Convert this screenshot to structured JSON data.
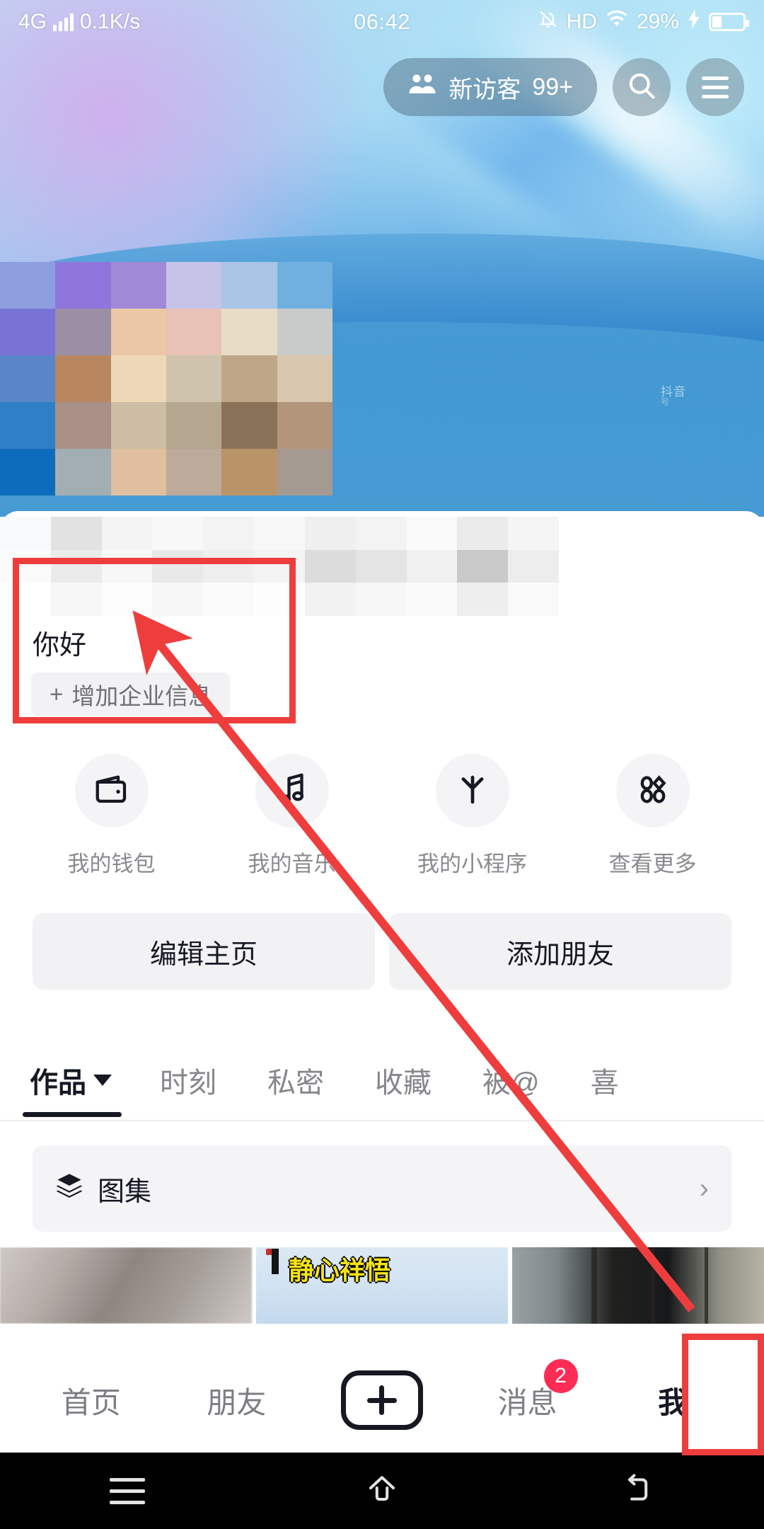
{
  "status_bar": {
    "network": "4G",
    "speed": "0.1K/s",
    "time": "06:42",
    "hd": "HD",
    "battery_percent": "29%",
    "signal_icon": "signal-bars-icon",
    "mute_icon": "bell-muted-icon",
    "wifi_icon": "wifi-icon",
    "charging_icon": "charging-bolt-icon",
    "battery_icon": "battery-icon"
  },
  "header": {
    "visitor_pill": {
      "icon": "people-icon",
      "label": "新访客",
      "count": "99+"
    },
    "search_icon": "search-icon",
    "menu_icon": "hamburger-menu-icon",
    "watermark": "抖音",
    "watermark_sub": "号"
  },
  "profile": {
    "bio": "你好",
    "business_info_label": "增加企业信息",
    "business_info_plus": "+"
  },
  "quick_actions": [
    {
      "icon": "wallet-icon",
      "label": "我的钱包"
    },
    {
      "icon": "music-note-icon",
      "label": "我的音乐"
    },
    {
      "icon": "mini-program-asterisk-icon",
      "label": "我的小程序"
    },
    {
      "icon": "grid-apps-icon",
      "label": "查看更多"
    }
  ],
  "primary_buttons": [
    {
      "label": "编辑主页"
    },
    {
      "label": "添加朋友"
    }
  ],
  "tabs": [
    {
      "label": "作品",
      "active": true,
      "has_caret": true
    },
    {
      "label": "时刻",
      "active": false
    },
    {
      "label": "私密",
      "active": false
    },
    {
      "label": "收藏",
      "active": false
    },
    {
      "label": "被@",
      "active": false
    },
    {
      "label": "喜",
      "active": false
    }
  ],
  "album_row": {
    "icon": "layers-icon",
    "label": "图集",
    "chevron": "›"
  },
  "video_grid": [
    {
      "caption": ""
    },
    {
      "caption": "静心祥悟"
    },
    {
      "caption": ""
    }
  ],
  "bottom_nav": [
    {
      "label": "首页",
      "active": false
    },
    {
      "label": "朋友",
      "active": false
    },
    {
      "label": "",
      "icon": "plus-create-icon",
      "active": false
    },
    {
      "label": "消息",
      "badge": "2",
      "active": false
    },
    {
      "label": "我",
      "active": true
    }
  ],
  "android_nav": [
    {
      "icon": "recents-icon"
    },
    {
      "icon": "home-icon"
    },
    {
      "icon": "back-icon"
    }
  ],
  "annotations": {
    "color": "#ee3d3d",
    "box_bio_target": "你好",
    "box_me_target": "我",
    "arrow": "arrow-pointing-from-me-tab-to-bio"
  },
  "colors": {
    "accent_red": "#fe2c55",
    "annotation_red": "#ee3d3d",
    "text_primary": "#161823",
    "text_secondary": "#86868b",
    "chip_bg": "#f2f2f4",
    "banner_blue": "#2f86cf"
  },
  "mosaic": {
    "avatar_tiles": [
      "#8e9fe0",
      "#8f76dd",
      "#a08ad8",
      "#c5c3e8",
      "#a8c5e6",
      "#6fb0e0",
      "#7a73d6",
      "#9b8fa5",
      "#ecc7a6",
      "#e8c2b6",
      "#e8dcc6",
      "#c9cbcb",
      "#5a86c9",
      "#b9875f",
      "#ecd8b6",
      "#cfc3ad",
      "#bfa686",
      "#d9c6ae",
      "#2f7fc6",
      "#a89086",
      "#cdbda4",
      "#b5a68f",
      "#8a7259",
      "#b2957a",
      "#0d6cbb",
      "#a3aeb3",
      "#dfbf9f",
      "#bcab9c",
      "#b99468",
      "#a49a92"
    ],
    "name_tiles": [
      "#f8f9fa",
      "#e2e2e2",
      "#f4f4f4",
      "#f8f8f8",
      "#f3f3f3",
      "#f8f8f8",
      "#efefef",
      "#f3f3f3",
      "#fafafa",
      "#ebebeb",
      "#f5f5f5",
      "#fbfbfb",
      "#ebebeb",
      "#f7f7f7",
      "#e9e9e9",
      "#efefef",
      "#f4f4f4",
      "#dcdcdc",
      "#e4e4e4",
      "#f0f0f0",
      "#c9c9c9",
      "#ededed",
      "#ffffff",
      "#f7f7f7",
      "#fcfcfc",
      "#f6f6f6",
      "#fbfbfb",
      "#fdfdfd",
      "#f2f2f2",
      "#f7f7f7",
      "#fafafa",
      "#eeeeee",
      "#f9f9f9"
    ]
  }
}
